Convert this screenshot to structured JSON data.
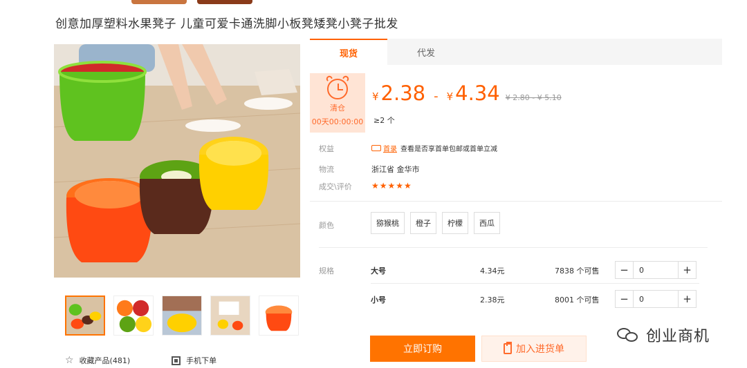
{
  "product": {
    "title": "创意加厚塑料水果凳子 儿童可爱卡通洗脚小板凳矮凳小凳子批发"
  },
  "gallery": {
    "thumbnail_count": 5
  },
  "actions": {
    "favorite_label": "收藏产品(481)",
    "mobile_label": "手机下单"
  },
  "tabs": [
    {
      "label": "现货"
    },
    {
      "label": "代发"
    }
  ],
  "clearance": {
    "label": "清仓",
    "timer": "00天00:00:00"
  },
  "price": {
    "currency": "¥",
    "low": "2.38",
    "high": "4.34",
    "original": "¥ 2.80 - ¥ 5.10",
    "min_qty": "≥2 个"
  },
  "info": {
    "benefit_label": "权益",
    "benefit_badge": "首录",
    "benefit_text": "查看是否享首单包邮或首单立减",
    "logistics_label": "物流",
    "logistics_value": "浙江省 金华市",
    "rating_label": "成交\\评价",
    "rating_stars": "★★★★★",
    "rating_value": 5
  },
  "color": {
    "label": "颜色",
    "options": [
      "猕猴桃",
      "橙子",
      "柠檬",
      "西瓜"
    ]
  },
  "specs": {
    "label": "规格",
    "rows": [
      {
        "name": "大号",
        "price": "4.34元",
        "stock": "7838 个可售",
        "qty": "0"
      },
      {
        "name": "小号",
        "price": "2.38元",
        "stock": "8001 个可售",
        "qty": "0"
      }
    ]
  },
  "buttons": {
    "buy": "立即订购",
    "cart": "加入进货单"
  },
  "watermark": {
    "text": "创业商机"
  },
  "colors": {
    "accent": "#ff6000",
    "button": "#ff7300"
  }
}
